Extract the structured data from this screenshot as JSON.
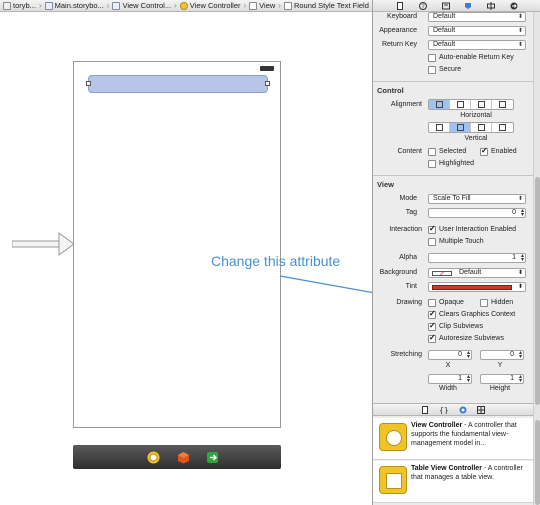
{
  "breadcrumb": {
    "items": [
      {
        "label": "toryb..."
      },
      {
        "label": "Main.storybo..."
      },
      {
        "label": "View Control..."
      },
      {
        "label": "View Controller"
      },
      {
        "label": "View"
      },
      {
        "label": "Round Style Text Field"
      }
    ]
  },
  "annotation": {
    "text": "Change this attribute",
    "color": "#4a8fd0"
  },
  "inspector": {
    "top": {
      "keyboard": {
        "label": "Keyboard",
        "value": "Default"
      },
      "appearance": {
        "label": "Appearance",
        "value": "Default"
      },
      "return_key": {
        "label": "Return Key",
        "value": "Default"
      },
      "auto_enable": {
        "label": "Auto-enable Return Key",
        "checked": false
      },
      "secure": {
        "label": "Secure",
        "checked": false
      }
    },
    "control": {
      "title": "Control",
      "alignment_label": "Alignment",
      "horizontal_label": "Horizontal",
      "vertical_label": "Vertical",
      "content_label": "Content",
      "selected": {
        "label": "Selected",
        "checked": false
      },
      "enabled": {
        "label": "Enabled",
        "checked": true
      },
      "highlighted": {
        "label": "Highlighted",
        "checked": false
      }
    },
    "view": {
      "title": "View",
      "mode": {
        "label": "Mode",
        "value": "Scale To Fill"
      },
      "tag": {
        "label": "Tag",
        "value": "0"
      },
      "interaction_label": "Interaction",
      "user_interaction": {
        "label": "User Interaction Enabled",
        "checked": true
      },
      "multiple_touch": {
        "label": "Multiple Touch",
        "checked": false
      },
      "alpha": {
        "label": "Alpha",
        "value": "1"
      },
      "background": {
        "label": "Background",
        "value": "Default"
      },
      "tint": {
        "label": "Tint",
        "color": "#c43c2a"
      },
      "drawing_label": "Drawing",
      "opaque": {
        "label": "Opaque",
        "checked": false
      },
      "hidden": {
        "label": "Hidden",
        "checked": false
      },
      "clears_graphics": {
        "label": "Clears Graphics Context",
        "checked": true
      },
      "clip_subviews": {
        "label": "Clip Subviews",
        "checked": true
      },
      "autoresize": {
        "label": "Autoresize Subviews",
        "checked": true
      },
      "stretching_label": "Stretching",
      "stretch_x": {
        "value": "0",
        "caption": "X"
      },
      "stretch_y": {
        "value": "0",
        "caption": "Y"
      },
      "stretch_w": {
        "value": "1",
        "caption": "Width"
      },
      "stretch_h": {
        "value": "1",
        "caption": "Height"
      }
    }
  },
  "library": {
    "items": [
      {
        "title": "View Controller",
        "desc": " - A controller that supports the fundamental view-management model in..."
      },
      {
        "title": "Table View Controller",
        "desc": " - A controller that manages a table view."
      }
    ]
  },
  "colors": {
    "selection": "#b7c6e6",
    "tint": "#c43c2a",
    "accent": "#4a8fd0"
  }
}
